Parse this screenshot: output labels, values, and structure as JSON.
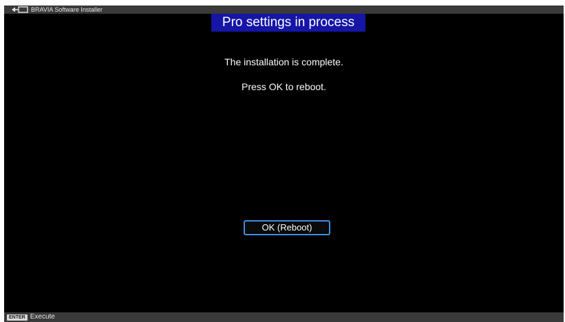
{
  "app_bar": {
    "icon": "input-source-icon",
    "title": "BRAVIA Software Installer"
  },
  "dialog": {
    "title": "Pro settings in process",
    "message_line_1": "The installation is complete.",
    "message_line_2": "Press OK to reboot.",
    "ok_button_label": "OK (Reboot)"
  },
  "bottom_bar": {
    "key_label": "ENTER",
    "key_action": "Execute"
  },
  "colors": {
    "background": "#000000",
    "title_banner": "#1515a6",
    "button_border": "#3d8fe0",
    "bar": "#3a3a3a"
  }
}
